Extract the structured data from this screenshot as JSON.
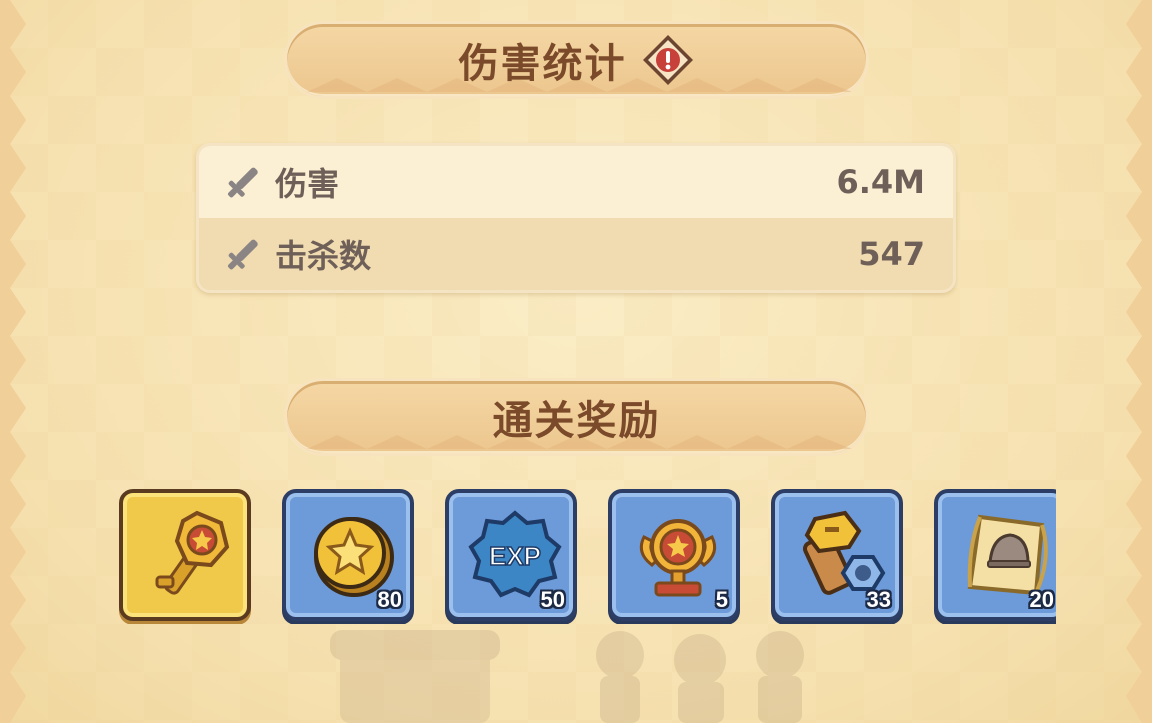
{
  "damage_stats": {
    "title": "伤害统计",
    "info_icon": "warning-diamond-icon",
    "rows": [
      {
        "icon": "sword-icon",
        "label": "伤害",
        "value": "6.4M"
      },
      {
        "icon": "sword-icon",
        "label": "击杀数",
        "value": "547"
      }
    ]
  },
  "rewards": {
    "title": "通关奖励",
    "items": [
      {
        "icon": "golden-key-icon",
        "count": "",
        "rarity": "gold"
      },
      {
        "icon": "gold-coin-icon",
        "count": "80",
        "rarity": "blue"
      },
      {
        "icon": "exp-badge-icon",
        "count": "50",
        "rarity": "blue"
      },
      {
        "icon": "trophy-icon",
        "count": "5",
        "rarity": "blue"
      },
      {
        "icon": "bolt-and-nut-icon",
        "count": "33",
        "rarity": "blue"
      },
      {
        "icon": "helmet-scroll-icon",
        "count": "20",
        "rarity": "blue"
      }
    ]
  },
  "colors": {
    "background": "#f6e1b0",
    "banner": "#ecc68e",
    "title_text": "#7a4a2a",
    "stat_text": "#6e6058",
    "slot_gold": "#f0c94a",
    "slot_blue": "#6d9ad8"
  }
}
